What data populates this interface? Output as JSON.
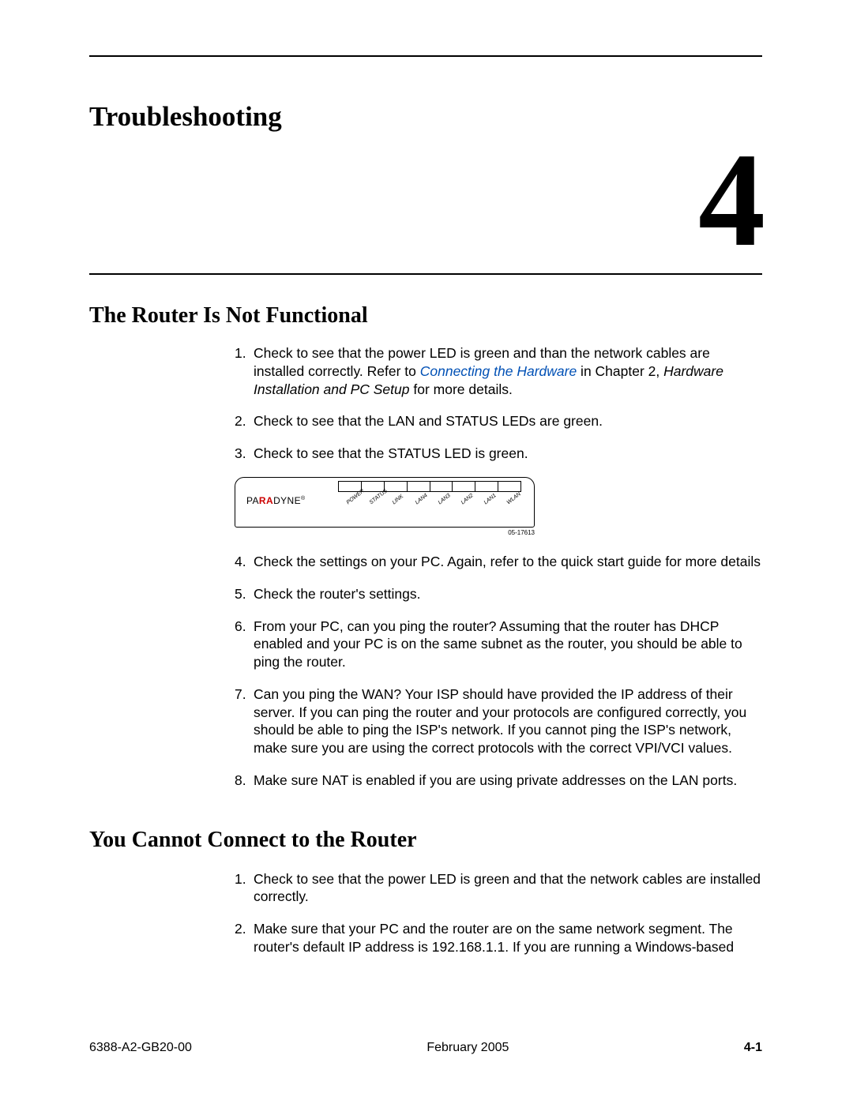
{
  "chapter": {
    "title": "Troubleshooting",
    "number": "4"
  },
  "section1": {
    "title": "The Router Is Not Functional",
    "steps": {
      "s1a": "Check to see that the power LED is green and than the network cables are installed correctly. Refer to ",
      "s1link": "Connecting the Hardware",
      "s1b": " in Chapter 2, ",
      "s1i": "Hardware Installation and PC Setup",
      "s1c": " for more details.",
      "s2": "Check to see that the LAN and STATUS LEDs are green.",
      "s3": "Check to see that the STATUS LED is green.",
      "s4": "Check the settings on your PC. Again, refer to the quick start guide for more details",
      "s5": "Check the router's settings.",
      "s6": "From your PC, can you ping the router? Assuming that the router has DHCP enabled and your PC is on the same subnet as the router, you should be able to ping the router.",
      "s7": "Can you ping the WAN? Your ISP should have provided the IP address of their server. If you can ping the router and your protocols are configured correctly, you should be able to ping the ISP's network. If you cannot ping the ISP's network, make sure you are using the correct protocols with the correct VPI/VCI values.",
      "s8": "Make sure NAT is enabled if you are using private addresses on the LAN ports."
    }
  },
  "figure": {
    "brand_pa": "PA",
    "brand_ra": "RA",
    "brand_dyne": "DYNE",
    "brand_reg": "®",
    "leds": [
      "POWER",
      "STATUS",
      "LINK",
      "LAN4",
      "LAN3",
      "LAN2",
      "LAN1",
      "WLAN"
    ],
    "num": "05-17613"
  },
  "section2": {
    "title": "You Cannot Connect to the Router",
    "steps": {
      "s1": "Check to see that the power LED is green and that the network cables are installed correctly.",
      "s2": "Make sure that your PC and the router are on the same network segment. The router's default IP address is 192.168.1.1. If you are running a Windows-based"
    }
  },
  "footer": {
    "docnum": "6388-A2-GB20-00",
    "date": "February 2005",
    "page": "4-1"
  }
}
